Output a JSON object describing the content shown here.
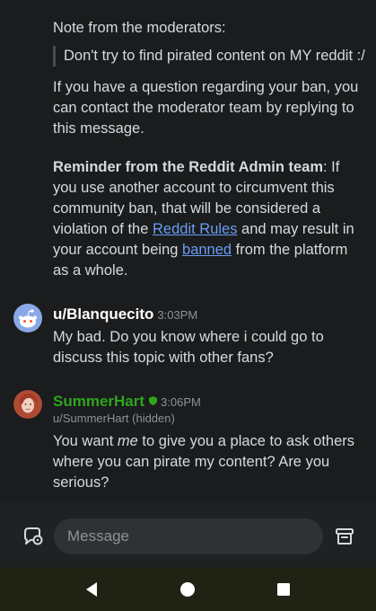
{
  "thread": {
    "note_heading": "Note from the moderators:",
    "note_quote": "Don't try to find pirated content on MY reddit :/",
    "note_body": "If you have a question regarding your ban, you can contact the moderator team by replying to this message.",
    "reminder": {
      "bold": "Reminder from the Reddit Admin team",
      "text1": ": If you use another account to circumvent this community ban, that will be considered a violation of the ",
      "link1": "Reddit Rules",
      "text2": " and may result in your account being ",
      "link2": "banned",
      "text3": " from the platform as a whole."
    }
  },
  "messages": [
    {
      "username": "u/Blanquecito",
      "time": "3:03PM",
      "text": "My bad. Do you know where i could go to discuss this topic with other fans?",
      "color": "#ffffff"
    },
    {
      "username": "SummerHart",
      "time": "3:06PM",
      "subtitle": "u/SummerHart (hidden)",
      "text_before": "You want ",
      "text_emph": "me",
      "text_after": " to give you a place to ask others where you can pirate my content? Are you serious?",
      "color": "#2fa51f"
    }
  ],
  "composer": {
    "placeholder": "Message"
  },
  "colors": {
    "background": "#1a1c1d",
    "link": "#6a9ef5",
    "mod_green": "#2fa51f"
  }
}
